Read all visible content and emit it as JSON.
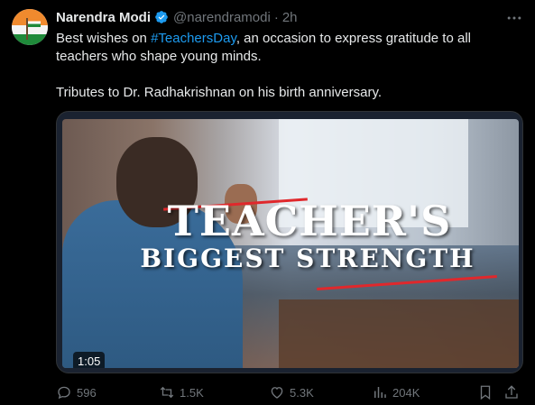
{
  "author": {
    "name": "Narendra Modi",
    "handle": "@narendramodi",
    "separator": "·",
    "time": "2h"
  },
  "tweet": {
    "line1_before": "Best wishes on ",
    "hashtag": "#TeachersDay",
    "line1_after": ", an occasion to express gratitude to all teachers who shape young minds.",
    "line2": "Tributes to Dr. Radhakrishnan on his birth anniversary."
  },
  "media": {
    "headline_line1": "TEACHER'S",
    "headline_line2": "BIGGEST STRENGTH",
    "duration": "1:05"
  },
  "actions": {
    "replies": "596",
    "reposts": "1.5K",
    "likes": "5.3K",
    "views": "204K"
  },
  "icons": {
    "verified": "verified-badge-icon",
    "more": "more-dots-icon",
    "reply": "reply-icon",
    "repost": "repost-icon",
    "like": "heart-icon",
    "views": "views-bar-chart-icon",
    "bookmark": "bookmark-icon",
    "share": "share-icon"
  },
  "colors": {
    "background": "#000000",
    "text": "#e7e9ea",
    "muted": "#71767b",
    "link": "#1d9bf0",
    "verified": "#1d9bf0",
    "headline_accent": "#e0282c"
  }
}
